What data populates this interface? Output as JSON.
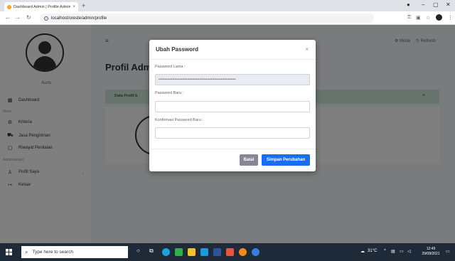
{
  "browser": {
    "tab_title": "Dashboard Admin | Profile Admin",
    "tab_close": "×",
    "new_tab": "+",
    "url": "localhost/oreste/admin/profile"
  },
  "sidebar": {
    "username": "Auris",
    "items": [
      {
        "label": "Dashboard",
        "icon": "dashboard-icon"
      },
      {
        "label": "Kriteria",
        "icon": "criteria-icon"
      },
      {
        "label": "Jasa Pengiriman",
        "icon": "shipping-icon"
      },
      {
        "label": "Riwayat Penilaian",
        "icon": "history-icon"
      },
      {
        "label": "Profil Saya",
        "icon": "user-icon"
      },
      {
        "label": "Keluar",
        "icon": "logout-icon"
      }
    ],
    "section_menu": "Menu",
    "section_admin": "Administrator"
  },
  "header": {
    "title": "Profil Admin",
    "mode_label": "Mode",
    "refresh_label": "Refresh"
  },
  "info_bar": {
    "text": "Data Profil b"
  },
  "modal": {
    "title": "Ubah Password",
    "close": "×",
    "old_password_label": "Password Lama :",
    "old_password_value": "••••••••••••••••••••••••••••••••••••••••••••••••••••••••••••••",
    "new_password_label": "Password Baru :",
    "confirm_password_label": "Konfirmasi Password Baru :",
    "cancel_label": "Batal",
    "save_label": "Simpan Perubahan"
  },
  "taskbar": {
    "search_placeholder": "Type here to search",
    "temperature": "31°C",
    "time": "12:49",
    "date": "29/08/2021"
  },
  "colors": {
    "primary": "#1a6cf2",
    "secondary": "#858796",
    "alert_bg": "#cfe9dd"
  }
}
